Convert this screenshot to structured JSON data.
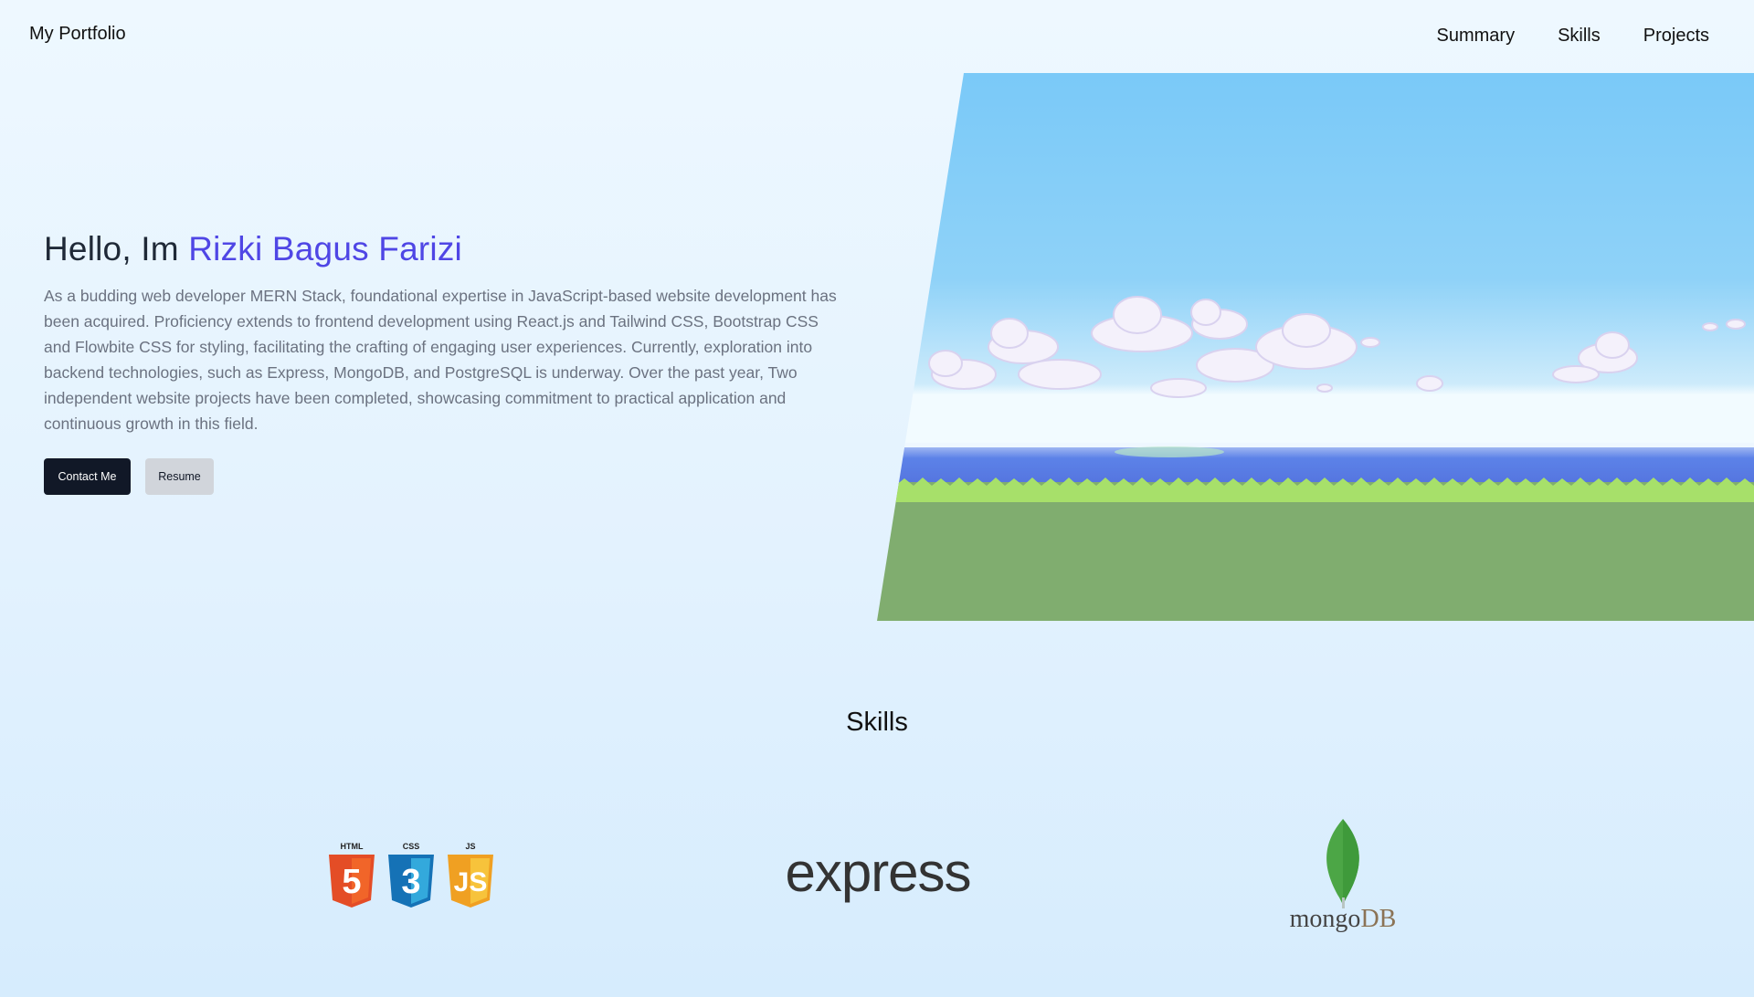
{
  "brand": "My Portfolio",
  "nav": [
    "Summary",
    "Skills",
    "Projects"
  ],
  "hero": {
    "greeting": "Hello, Im ",
    "name": "Rizki Bagus Farizi",
    "description": "As a budding web developer MERN Stack, foundational expertise in JavaScript-based website development has been acquired. Proficiency extends to frontend development using React.js and Tailwind CSS, Bootstrap CSS and Flowbite CSS for styling, facilitating the crafting of engaging user experiences. Currently, exploration into backend technologies, such as Express, MongoDB, and PostgreSQL is underway. Over the past year, Two independent website projects have been completed, showcasing commitment to practical application and continuous growth in this field.",
    "contact_label": "Contact Me",
    "resume_label": "Resume"
  },
  "skills": {
    "title": "Skills",
    "web_badges": [
      "HTML",
      "CSS",
      "JS"
    ],
    "express_label": "express",
    "mongo_label_a": "mongo",
    "mongo_label_b": "DB"
  },
  "colors": {
    "accent": "#4f46e5",
    "sky": "#7ecbfa",
    "water": "#5b80e6",
    "grass": "#80ad6f"
  }
}
